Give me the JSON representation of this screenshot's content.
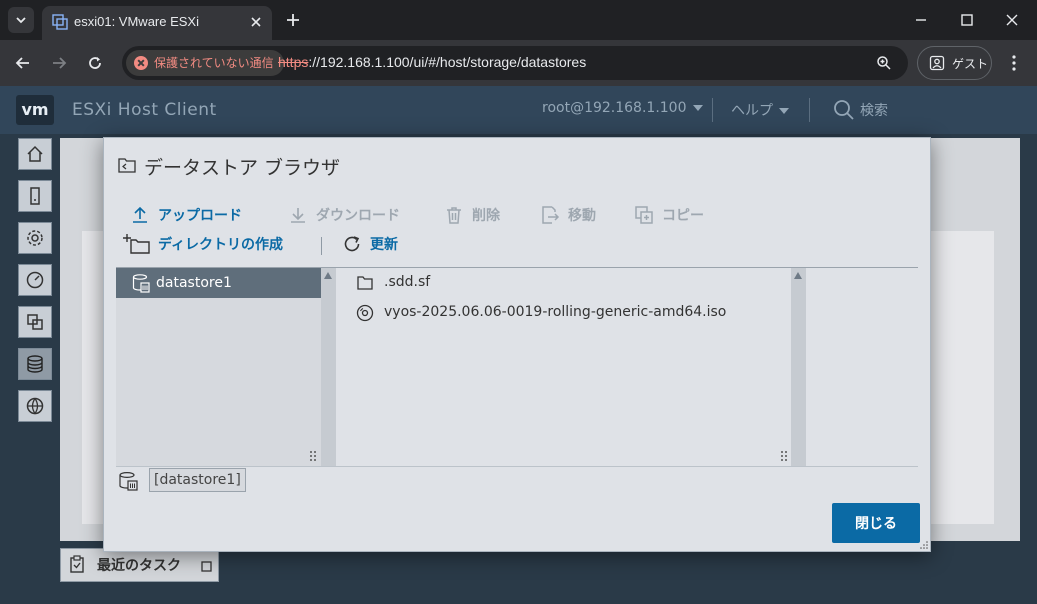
{
  "browser": {
    "tab_title": "esxi01: VMware ESXi",
    "security_label": "保護されていない通信",
    "url_scheme": "https",
    "url_rest": "://192.168.1.100/ui/#/host/storage/datastores",
    "profile_label": "ゲスト"
  },
  "app": {
    "logo": "vm",
    "title": "ESXi Host Client",
    "user": "root@192.168.1.100",
    "help": "ヘルプ",
    "search": "検索",
    "recent_tasks": "最近のタスク"
  },
  "dialog": {
    "title": "データストア ブラウザ",
    "toolbar": {
      "upload": "アップロード",
      "download": "ダウンロード",
      "delete": "削除",
      "move": "移動",
      "copy": "コピー",
      "mkdir": "ディレクトリの作成",
      "refresh": "更新"
    },
    "datastores": [
      {
        "name": "datastore1",
        "selected": true
      }
    ],
    "files": [
      {
        "name": ".sdd.sf",
        "type": "folder"
      },
      {
        "name": "vyos-2025.06.06-0019-rolling-generic-amd64.iso",
        "type": "iso"
      }
    ],
    "current_path": "[datastore1]",
    "close_label": "閉じる"
  },
  "colors": {
    "accent": "#0b6aa5",
    "header_bg": "#31465a",
    "selected_row": "#5f6e7b",
    "insecure": "#f28b82"
  }
}
